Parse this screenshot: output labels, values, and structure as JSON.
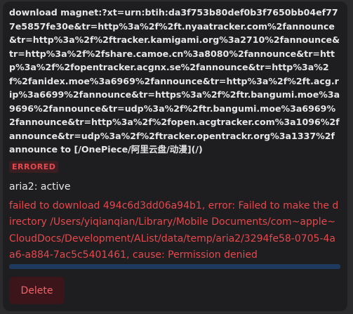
{
  "task": {
    "description": "download magnet:?xt=urn:btih:da3f753b80def0b3f7650bb04ef777e5857fe30e&tr=http%3a%2f%2ft.nyaatracker.com%2fannounce&tr=http%3a%2f%2ftracker.kamigami.org%3a2710%2fannounce&tr=http%3a%2f%2fshare.camoe.cn%3a8080%2fannounce&tr=http%3a%2f%2fopentracker.acgnx.se%2fannounce&tr=http%3a%2f%2fanidex.moe%3a6969%2fannounce&tr=http%3a%2f%2ft.acg.rip%3a6699%2fannounce&tr=https%3a%2f%2ftr.bangumi.moe%3a9696%2fannounce&tr=udp%3a%2f%2ftr.bangumi.moe%3a6969%2fannounce&tr=http%3a%2f%2fopen.acgtracker.com%3a1096%2fannounce&tr=udp%3a%2f%2ftracker.opentrackr.org%3a1337%2fannounce to [/OnePiece/阿里云盘/动漫](/)",
    "status": "ERRORED",
    "engine_status": "aria2: active",
    "error_message": "failed to download 494c6d3dd06a94b1, error: Failed to make the directory /Users/yiqianqian/Library/Mobile Documents/com~apple~CloudDocs/Development/AList/data/temp/aria2/3294fe58-0705-4aa6-a884-7ac5c5401461, cause: Permission denied",
    "progress": 1.0
  },
  "actions": {
    "delete_label": "Delete"
  },
  "colors": {
    "error": "#e5484d",
    "progress": "#1e3a5f"
  }
}
